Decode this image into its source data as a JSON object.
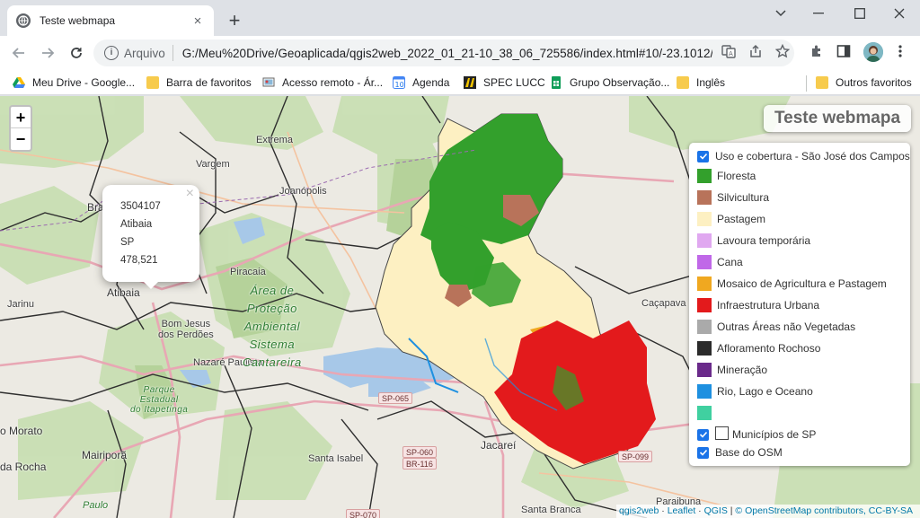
{
  "browser": {
    "tab_title": "Teste webmapa",
    "tab_close": "×",
    "new_tab": "+",
    "scheme_label": "Arquivo",
    "url": "G:/Meu%20Drive/Geoaplicada/qgis2web_2022_01_21-10_38_06_725586/index.html#10/-23.1012/..."
  },
  "bookmarks": [
    {
      "label": "Meu Drive - Google...",
      "icon": "google-drive-icon"
    },
    {
      "label": "Barra de favoritos",
      "icon": "folder-icon"
    },
    {
      "label": "Acesso remoto - Ár...",
      "icon": "remote-access-icon"
    },
    {
      "label": "Agenda",
      "icon": "calendar-icon"
    },
    {
      "label": "SPEC LUCC",
      "icon": "spec-lucc-icon"
    },
    {
      "label": "Grupo Observação...",
      "icon": "google-sheets-icon"
    },
    {
      "label": "Inglês",
      "icon": "folder-icon"
    },
    {
      "label": "Outros favoritos",
      "icon": "folder-icon"
    }
  ],
  "map": {
    "title": "Teste webmapa",
    "zoom_in": "+",
    "zoom_out": "−",
    "popup": {
      "lines": [
        "3504107",
        "Atibaia",
        "SP",
        "478,521"
      ],
      "close": "×"
    },
    "place_labels": {
      "extrema": "Extrema",
      "vargem": "Vargem",
      "joanopolis": "Joanópolis",
      "bragança": "Bra",
      "piracaia": "Piracaia",
      "atibaia": "Atibaia",
      "jarinu": "Jarinu",
      "bom_jesus": "Bom Jesus\ndos Perdões",
      "nazare": "Nazaré Paulista",
      "cacapava": "Caçapava",
      "jacarei": "Jacareí",
      "santa_isabel": "Santa Isabel",
      "mairipora": "Mairiporã",
      "morato": "o Morato",
      "da_rocha": "da Rocha",
      "santa_branca": "Santa Branca",
      "paraibuna": "Paraibuna",
      "apa": "Área de\nProteção\nAmbiental\nSistema\nCantareira",
      "parque": "Parque\nEstadual\ndo Itapetinga",
      "paulo": "Paulo"
    },
    "road_shields": [
      "SP-065",
      "SP-060",
      "BR-116",
      "SP-099",
      "SP-070"
    ],
    "legend": {
      "group_label": "Uso e cobertura - São José dos Campos",
      "classes": [
        {
          "label": "Floresta",
          "color": "#33a02c"
        },
        {
          "label": "Silvicultura",
          "color": "#b8735a"
        },
        {
          "label": "Pastagem",
          "color": "#fdf0c2"
        },
        {
          "label": "Lavoura temporária",
          "color": "#e0a8f0"
        },
        {
          "label": "Cana",
          "color": "#c068e8"
        },
        {
          "label": "Mosaico de Agricultura e Pastagem",
          "color": "#f0a820"
        },
        {
          "label": "Infraestrutura Urbana",
          "color": "#e31a1c"
        },
        {
          "label": "Outras Áreas não Vegetadas",
          "color": "#aaaaaa"
        },
        {
          "label": "Afloramento Rochoso",
          "color": "#2b2b2b"
        },
        {
          "label": "Mineração",
          "color": "#6a2a8a"
        },
        {
          "label": "Rio, Lago e Oceano",
          "color": "#1e90e0"
        },
        {
          "label": "",
          "color": "#40d0a0"
        }
      ],
      "municipios_label": "Municípios de SP",
      "osm_label": "Base do OSM"
    },
    "attribution": {
      "qgis2web": "qgis2web",
      "leaflet": "Leaflet",
      "qgis": "QGIS",
      "osm": "© OpenStreetMap contributors, CC-BY-SA",
      "dot1": " · ",
      "dot2": " · ",
      "bar": " | "
    }
  }
}
